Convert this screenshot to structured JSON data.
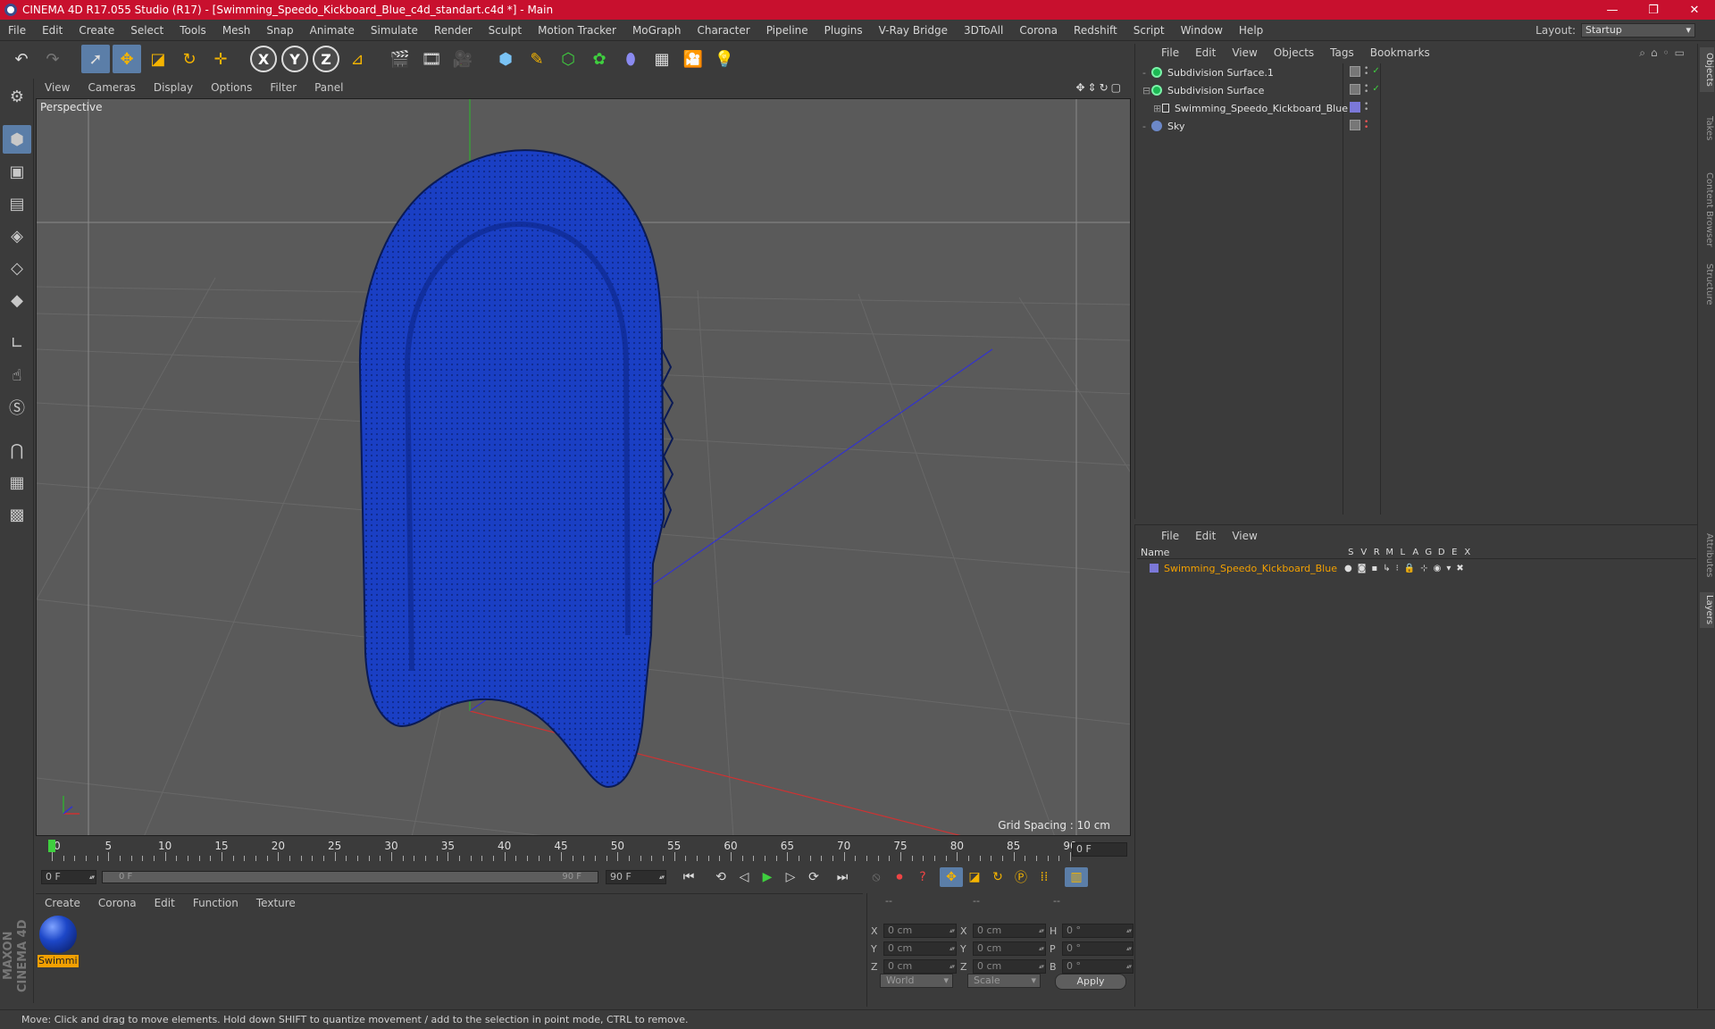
{
  "window": {
    "title": "CINEMA 4D R17.055 Studio (R17) - [Swimming_Speedo_Kickboard_Blue_c4d_standart.c4d *] - Main",
    "minimize": "—",
    "maximize": "❐",
    "close": "✕"
  },
  "menubar": {
    "items": [
      "File",
      "Edit",
      "Create",
      "Select",
      "Tools",
      "Mesh",
      "Snap",
      "Animate",
      "Simulate",
      "Render",
      "Sculpt",
      "Motion Tracker",
      "MoGraph",
      "Character",
      "Pipeline",
      "Plugins",
      "V-Ray Bridge",
      "3DToAll",
      "Corona",
      "Redshift",
      "Script",
      "Window",
      "Help"
    ],
    "layout_label": "Layout:",
    "layout_value": "Startup"
  },
  "toolbar": {
    "axis_x": "X",
    "axis_y": "Y",
    "axis_z": "Z"
  },
  "viewport": {
    "menu": [
      "View",
      "Cameras",
      "Display",
      "Options",
      "Filter",
      "Panel"
    ],
    "label": "Perspective",
    "grid_spacing": "Grid Spacing : 10 cm",
    "object_color": "#1a3fc4"
  },
  "timeline": {
    "ticks": [
      "0",
      "5",
      "10",
      "15",
      "20",
      "25",
      "30",
      "35",
      "40",
      "45",
      "50",
      "55",
      "60",
      "65",
      "70",
      "75",
      "80",
      "85",
      "90"
    ],
    "current_frame": "0 F"
  },
  "transport": {
    "start_field": "0 F",
    "range_start": "0 F",
    "range_end": "90 F",
    "end_field": "90 F"
  },
  "material_manager": {
    "menu": [
      "Create",
      "Corona",
      "Edit",
      "Function",
      "Texture"
    ],
    "material_name": "Swimmi"
  },
  "coordinates": {
    "headers": [
      "--",
      "--",
      "--"
    ],
    "rows": [
      {
        "axis1": "X",
        "pos": "0 cm",
        "axis2": "X",
        "size": "0 cm",
        "axis3": "H",
        "rot": "0 °"
      },
      {
        "axis1": "Y",
        "pos": "0 cm",
        "axis2": "Y",
        "size": "0 cm",
        "axis3": "P",
        "rot": "0 °"
      },
      {
        "axis1": "Z",
        "pos": "0 cm",
        "axis2": "Z",
        "size": "0 cm",
        "axis3": "B",
        "rot": "0 °"
      }
    ],
    "mode": "World",
    "scale": "Scale",
    "apply": "Apply"
  },
  "object_manager": {
    "menu": [
      "File",
      "Edit",
      "View",
      "Objects",
      "Tags",
      "Bookmarks"
    ],
    "objects": [
      {
        "name": "Subdivision Surface.1"
      },
      {
        "name": "Subdivision Surface"
      },
      {
        "name": "Swimming_Speedo_Kickboard_Blue"
      },
      {
        "name": "Sky"
      }
    ]
  },
  "layer_manager": {
    "menu": [
      "File",
      "Edit",
      "View"
    ],
    "columns": [
      "Name",
      "S",
      "V",
      "R",
      "M",
      "L",
      "A",
      "G",
      "D",
      "E",
      "X"
    ],
    "layer_name": "Swimming_Speedo_Kickboard_Blue"
  },
  "right_tabs": [
    "Objects",
    "Takes",
    "Content Browser",
    "Structure",
    "Attributes",
    "Layers"
  ],
  "maxon_logo": "MAXON CINEMA 4D",
  "status": "Move: Click and drag to move elements. Hold down SHIFT to quantize movement / add to the selection in point mode, CTRL to remove."
}
